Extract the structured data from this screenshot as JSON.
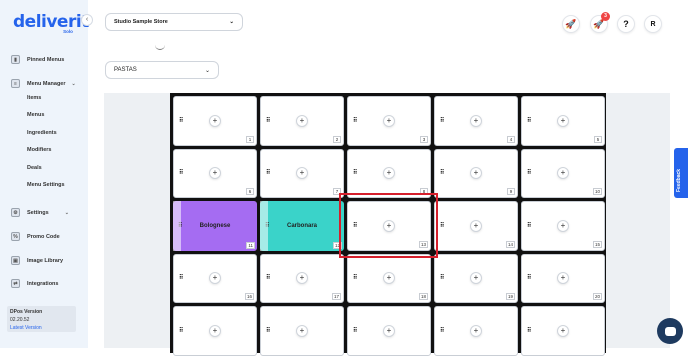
{
  "brand": {
    "name": "deliverit",
    "sub": "Solo"
  },
  "sidebar": {
    "items": [
      {
        "label": "Pinned Menus",
        "icon": "pin-icon"
      },
      {
        "label": "Menu Manager",
        "icon": "menu-icon"
      },
      {
        "label": "Settings",
        "icon": "settings-icon"
      },
      {
        "label": "Promo Code",
        "icon": "promo-icon"
      },
      {
        "label": "Image Library",
        "icon": "image-icon"
      },
      {
        "label": "Integrations",
        "icon": "integrations-icon"
      }
    ],
    "menu_manager_sub": [
      "Items",
      "Menus",
      "Ingredients",
      "Modifiers",
      "Deals",
      "Menu Settings"
    ]
  },
  "version": {
    "title": "DPos Version",
    "number": "02.20.52",
    "link": "Latest Version"
  },
  "header": {
    "store": "Studio Sample Store",
    "notification_count": "3",
    "help": "?",
    "avatar": "R"
  },
  "category": {
    "selected": "PASTAS"
  },
  "tiles": [
    {
      "num": "1"
    },
    {
      "num": "2"
    },
    {
      "num": "3"
    },
    {
      "num": "4"
    },
    {
      "num": "5"
    },
    {
      "num": "6"
    },
    {
      "num": "7"
    },
    {
      "num": "8"
    },
    {
      "num": "9"
    },
    {
      "num": "10"
    },
    {
      "num": "11",
      "name": "Bolognese",
      "color": "#a56cf2"
    },
    {
      "num": "12",
      "name": "Carbonara",
      "color": "#3ad3c9"
    },
    {
      "num": "13"
    },
    {
      "num": "14"
    },
    {
      "num": "15"
    },
    {
      "num": "16"
    },
    {
      "num": "17"
    },
    {
      "num": "18"
    },
    {
      "num": "19"
    },
    {
      "num": "20"
    },
    {
      "num": ""
    },
    {
      "num": ""
    },
    {
      "num": ""
    },
    {
      "num": ""
    },
    {
      "num": ""
    }
  ],
  "feedback": {
    "label": "Feedback"
  }
}
